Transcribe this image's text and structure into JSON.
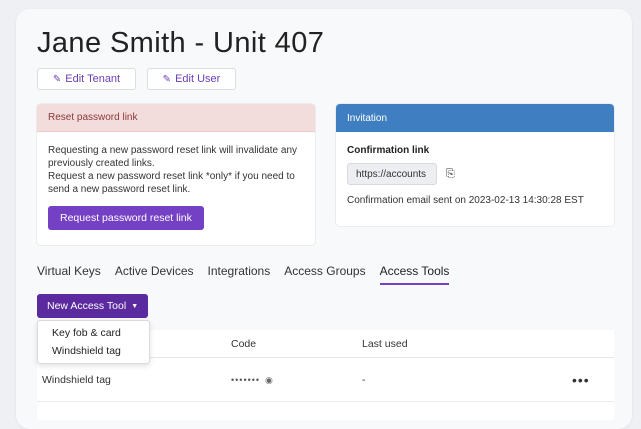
{
  "header": {
    "title": "Jane Smith - Unit 407",
    "edit_tenant_label": "Edit Tenant",
    "edit_user_label": "Edit User"
  },
  "reset_panel": {
    "header": "Reset password link",
    "text_lines": [
      "Requesting a new password reset link will invalidate any previously created links.",
      "Request a new password reset link *only* if you need to send a new password reset link."
    ],
    "button_label": "Request password reset link"
  },
  "invitation_panel": {
    "header": "Invitation",
    "confirmation_label": "Confirmation link",
    "confirmation_value": "https://accounts",
    "sent_note": "Confirmation email sent on 2023-02-13 14:30:28 EST"
  },
  "tabs": [
    {
      "label": "Virtual Keys",
      "active": false
    },
    {
      "label": "Active Devices",
      "active": false
    },
    {
      "label": "Integrations",
      "active": false
    },
    {
      "label": "Access Groups",
      "active": false
    },
    {
      "label": "Access Tools",
      "active": true
    }
  ],
  "new_tool": {
    "label": "New Access Tool",
    "menu_items": [
      "Key fob & card",
      "Windshield tag"
    ]
  },
  "table": {
    "columns": [
      "Code",
      "Last used"
    ],
    "rows": [
      {
        "name": "Windshield tag",
        "code": "•••••••",
        "last_used": "-"
      }
    ]
  },
  "colors": {
    "accent": "#7440c4",
    "accent_dark": "#5b2a9e",
    "info_header": "#3f7fc1",
    "danger_header_bg": "#f3dcdc"
  },
  "icons": {
    "edit": "edit-icon",
    "copy": "copy-icon",
    "eye": "eye-icon",
    "more": "more-horizontal-icon",
    "caret": "caret-down-icon"
  }
}
